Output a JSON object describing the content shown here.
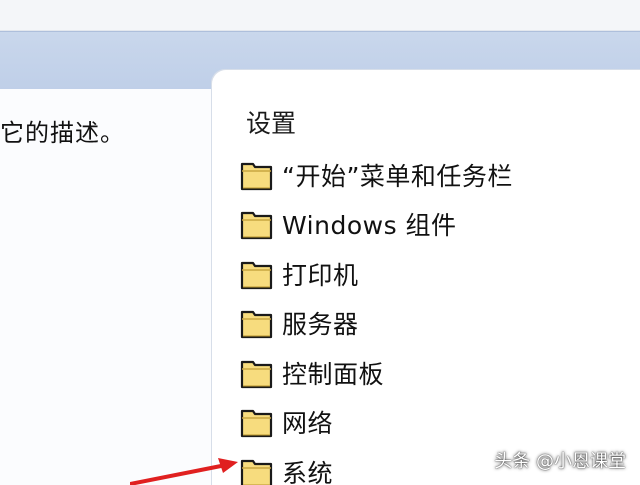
{
  "left_pane": {
    "description": "它的描述。"
  },
  "right_pane": {
    "section_header": "设置",
    "items": [
      {
        "label": "“开始”菜单和任务栏",
        "icon": "folder-icon"
      },
      {
        "label": "Windows 组件",
        "icon": "folder-icon"
      },
      {
        "label": "打印机",
        "icon": "folder-icon"
      },
      {
        "label": "服务器",
        "icon": "folder-icon"
      },
      {
        "label": "控制面板",
        "icon": "folder-icon"
      },
      {
        "label": "网络",
        "icon": "folder-icon"
      },
      {
        "label": "系统",
        "icon": "folder-icon"
      }
    ]
  },
  "watermark": "头条 @小恩课堂",
  "colors": {
    "folder_fill": "#f7dc7e",
    "folder_stroke": "#1a1a1a",
    "arrow": "#e02020",
    "header_band": "#c9d7ec"
  }
}
